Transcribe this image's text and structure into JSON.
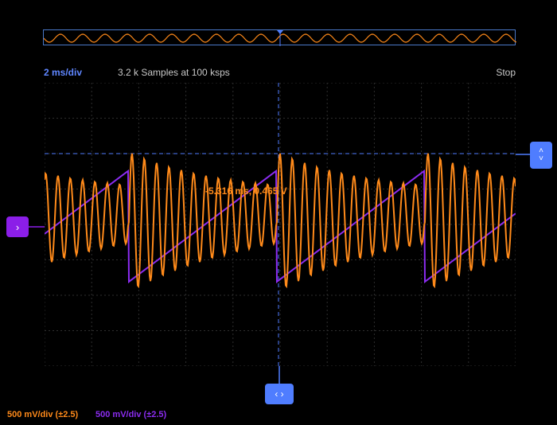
{
  "overview": {
    "label": ""
  },
  "header": {
    "timebase": "2 ms/div",
    "samples": "3.2 k Samples at 100 ksps",
    "run_state": "Stop"
  },
  "cursor_readout": "-5.316 ms, 0.465 V",
  "channels": [
    {
      "scale": "500 mV/div (±2.5)",
      "color": "#ff8a1a"
    },
    {
      "scale": "500 mV/div (±2.5)",
      "color": "#8b2cf0"
    }
  ],
  "handles": {
    "channel_marker": "›",
    "trigger_up": "˄",
    "trigger_down": "˅",
    "position": "‹ ›"
  },
  "colors": {
    "background": "#000000",
    "grid": "#2e2e2e",
    "accent": "#4f7dff",
    "ch1": "#ff8a1a",
    "ch2": "#8b2cf0"
  }
}
